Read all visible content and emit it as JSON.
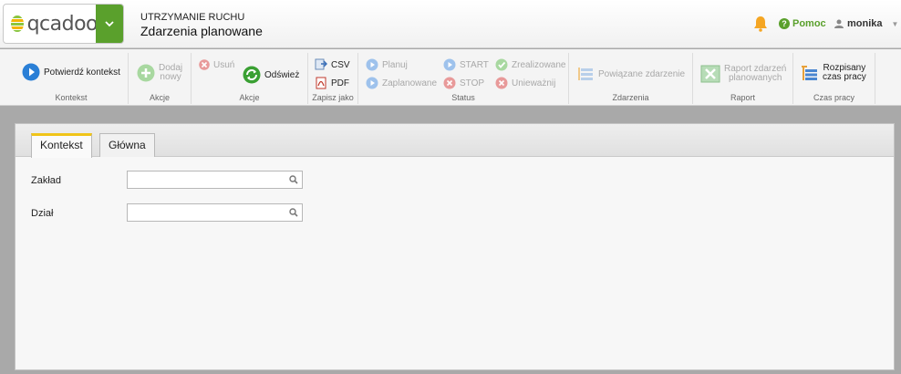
{
  "header": {
    "logo_text": "qcadoo",
    "section": "UTRZYMANIE RUCHU",
    "page_title": "Zdarzenia planowane",
    "help_label": "Pomoc",
    "user_name": "monika"
  },
  "ribbon": {
    "groups": {
      "kontekst": "Kontekst",
      "akcje1": "Akcje",
      "akcje2": "Akcje",
      "zapisz": "Zapisz jako",
      "status": "Status",
      "zdarzenia": "Zdarzenia",
      "raport": "Raport",
      "czas": "Czas pracy"
    },
    "buttons": {
      "confirm_context": "Potwierdź kontekst",
      "add_new_1": "Dodaj",
      "add_new_2": "nowy",
      "delete": "Usuń",
      "refresh": "Odśwież",
      "csv": "CSV",
      "pdf": "PDF",
      "plan": "Planuj",
      "planned": "Zaplanowane",
      "start": "START",
      "stop": "STOP",
      "realized": "Zrealizowane",
      "cancel": "Unieważnij",
      "related_event": "Powiązane zdarzenie",
      "report_1": "Raport zdarzeń",
      "report_2": "planowanych",
      "worktime_1": "Rozpisany",
      "worktime_2": "czas pracy"
    }
  },
  "tabs": [
    "Kontekst",
    "Główna"
  ],
  "form": {
    "plant_label": "Zakład",
    "plant_value": "",
    "department_label": "Dział",
    "department_value": ""
  },
  "colors": {
    "brand_green": "#5aa02c",
    "active_tab_accent": "#f0c419",
    "bell": "#f5a623"
  }
}
